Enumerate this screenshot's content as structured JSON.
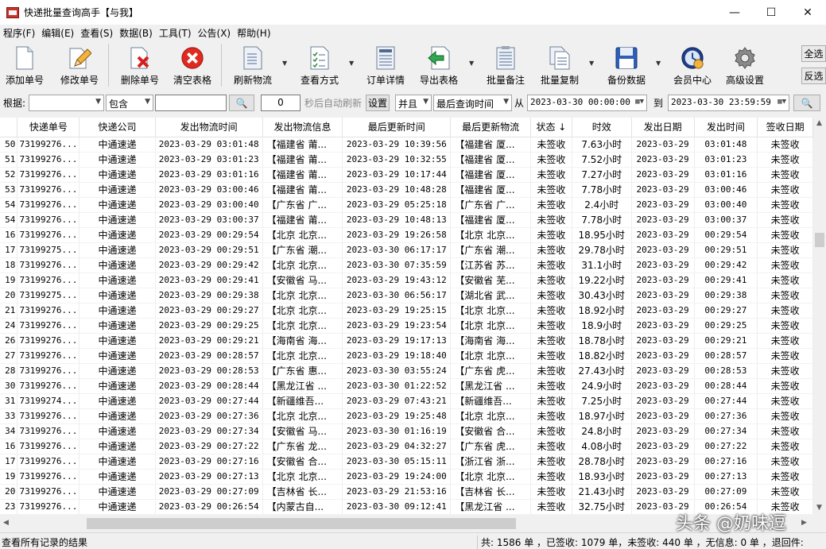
{
  "window": {
    "title": "快递批量查询高手【与我】",
    "minimize_glyph": "—",
    "maximize_glyph": "☐",
    "close_glyph": "✕"
  },
  "menu": [
    "程序(F)",
    "编辑(E)",
    "查看(S)",
    "数据(B)",
    "工具(T)",
    "公告(X)",
    "帮助(H)"
  ],
  "toolbar": {
    "buttons": [
      {
        "label": "添加单号",
        "icon": "document-icon"
      },
      {
        "label": "修改单号",
        "icon": "pencil-icon"
      },
      {
        "label": "删除单号",
        "icon": "delete-document-icon"
      },
      {
        "label": "清空表格",
        "icon": "red-x-circle-icon"
      },
      {
        "label": "刷新物流",
        "icon": "refresh-list-icon"
      },
      {
        "label": "查看方式",
        "icon": "checklist-icon"
      },
      {
        "label": "订单详情",
        "icon": "order-detail-icon"
      },
      {
        "label": "导出表格",
        "icon": "export-arrow-icon"
      },
      {
        "label": "批量备注",
        "icon": "note-icon"
      },
      {
        "label": "批量复制",
        "icon": "copy-icon"
      },
      {
        "label": "备份数据",
        "icon": "floppy-disk-icon"
      },
      {
        "label": "会员中心",
        "icon": "clock-user-icon"
      },
      {
        "label": "高级设置",
        "icon": "gear-icon"
      }
    ],
    "select_all": "全选",
    "invert_select": "反选"
  },
  "filter": {
    "label_basis": "根据:",
    "basis_value": "",
    "match_value": "包含",
    "search_text": "",
    "refresh_seconds": "0",
    "refresh_hint": "秒后自动刷新",
    "settings_button": "设置",
    "logic_value": "并且",
    "time_field_value": "最后查询时间",
    "from_label": "从",
    "from_datetime": "2023-03-30 00:00:00",
    "to_label": "到",
    "to_datetime": "2023-03-30 23:59:59"
  },
  "table": {
    "columns": [
      "",
      "快递单号",
      "快递公司",
      "发出物流时间",
      "发出物流信息",
      "最后更新时间",
      "最后更新物流",
      "状态 ↓",
      "时效",
      "发出日期",
      "发出时间",
      "签收日期"
    ],
    "rows": [
      [
        "50",
        "73199276...",
        "中通速递",
        "2023-03-29 03:01:48",
        "【福建省 莆...",
        "2023-03-29 10:39:56",
        "【福建省 厦...",
        "未签收",
        "7.63小时",
        "2023-03-29",
        "03:01:48",
        "未签收"
      ],
      [
        "51",
        "73199276...",
        "中通速递",
        "2023-03-29 03:01:23",
        "【福建省 莆...",
        "2023-03-29 10:32:55",
        "【福建省 厦...",
        "未签收",
        "7.52小时",
        "2023-03-29",
        "03:01:23",
        "未签收"
      ],
      [
        "52",
        "73199276...",
        "中通速递",
        "2023-03-29 03:01:16",
        "【福建省 莆...",
        "2023-03-29 10:17:44",
        "【福建省 厦...",
        "未签收",
        "7.27小时",
        "2023-03-29",
        "03:01:16",
        "未签收"
      ],
      [
        "53",
        "73199276...",
        "中通速递",
        "2023-03-29 03:00:46",
        "【福建省 莆...",
        "2023-03-29 10:48:28",
        "【福建省 厦...",
        "未签收",
        "7.78小时",
        "2023-03-29",
        "03:00:46",
        "未签收"
      ],
      [
        "54",
        "73199276...",
        "中通速递",
        "2023-03-29 03:00:40",
        "【广东省 广...",
        "2023-03-29 05:25:18",
        "【广东省 广...",
        "未签收",
        "2.4小时",
        "2023-03-29",
        "03:00:40",
        "未签收"
      ],
      [
        "54",
        "73199276...",
        "中通速递",
        "2023-03-29 03:00:37",
        "【福建省 莆...",
        "2023-03-29 10:48:13",
        "【福建省 厦...",
        "未签收",
        "7.78小时",
        "2023-03-29",
        "03:00:37",
        "未签收"
      ],
      [
        "16",
        "73199276...",
        "中通速递",
        "2023-03-29 00:29:54",
        "【北京 北京...",
        "2023-03-29 19:26:58",
        "【北京 北京...",
        "未签收",
        "18.95小时",
        "2023-03-29",
        "00:29:54",
        "未签收"
      ],
      [
        "17",
        "73199275...",
        "中通速递",
        "2023-03-29 00:29:51",
        "【广东省 潮...",
        "2023-03-30 06:17:17",
        "【广东省 潮...",
        "未签收",
        "29.78小时",
        "2023-03-29",
        "00:29:51",
        "未签收"
      ],
      [
        "18",
        "73199276...",
        "中通速递",
        "2023-03-29 00:29:42",
        "【北京 北京...",
        "2023-03-30 07:35:59",
        "【江苏省 苏...",
        "未签收",
        "31.1小时",
        "2023-03-29",
        "00:29:42",
        "未签收"
      ],
      [
        "19",
        "73199276...",
        "中通速递",
        "2023-03-29 00:29:41",
        "【安徽省 马...",
        "2023-03-29 19:43:12",
        "【安徽省 芜...",
        "未签收",
        "19.22小时",
        "2023-03-29",
        "00:29:41",
        "未签收"
      ],
      [
        "20",
        "73199275...",
        "中通速递",
        "2023-03-29 00:29:38",
        "【北京 北京...",
        "2023-03-30 06:56:17",
        "【湖北省 武...",
        "未签收",
        "30.43小时",
        "2023-03-29",
        "00:29:38",
        "未签收"
      ],
      [
        "21",
        "73199276...",
        "中通速递",
        "2023-03-29 00:29:27",
        "【北京 北京...",
        "2023-03-29 19:25:15",
        "【北京 北京...",
        "未签收",
        "18.92小时",
        "2023-03-29",
        "00:29:27",
        "未签收"
      ],
      [
        "24",
        "73199276...",
        "中通速递",
        "2023-03-29 00:29:25",
        "【北京 北京...",
        "2023-03-29 19:23:54",
        "【北京 北京...",
        "未签收",
        "18.9小时",
        "2023-03-29",
        "00:29:25",
        "未签收"
      ],
      [
        "26",
        "73199276...",
        "中通速递",
        "2023-03-29 00:29:21",
        "【海南省 海...",
        "2023-03-29 19:17:13",
        "【海南省 海...",
        "未签收",
        "18.78小时",
        "2023-03-29",
        "00:29:21",
        "未签收"
      ],
      [
        "27",
        "73199276...",
        "中通速递",
        "2023-03-29 00:28:57",
        "【北京 北京...",
        "2023-03-29 19:18:40",
        "【北京 北京...",
        "未签收",
        "18.82小时",
        "2023-03-29",
        "00:28:57",
        "未签收"
      ],
      [
        "28",
        "73199276...",
        "中通速递",
        "2023-03-29 00:28:53",
        "【广东省 惠...",
        "2023-03-30 03:55:24",
        "【广东省 虎...",
        "未签收",
        "27.43小时",
        "2023-03-29",
        "00:28:53",
        "未签收"
      ],
      [
        "30",
        "73199276...",
        "中通速递",
        "2023-03-29 00:28:44",
        "【黑龙江省 ...",
        "2023-03-30 01:22:52",
        "【黑龙江省 ...",
        "未签收",
        "24.9小时",
        "2023-03-29",
        "00:28:44",
        "未签收"
      ],
      [
        "31",
        "73199274...",
        "中通速递",
        "2023-03-29 00:27:44",
        "【新疆维吾...",
        "2023-03-29 07:43:21",
        "【新疆维吾...",
        "未签收",
        "7.25小时",
        "2023-03-29",
        "00:27:44",
        "未签收"
      ],
      [
        "33",
        "73199276...",
        "中通速递",
        "2023-03-29 00:27:36",
        "【北京 北京...",
        "2023-03-29 19:25:48",
        "【北京 北京...",
        "未签收",
        "18.97小时",
        "2023-03-29",
        "00:27:36",
        "未签收"
      ],
      [
        "34",
        "73199276...",
        "中通速递",
        "2023-03-29 00:27:34",
        "【安徽省 马...",
        "2023-03-30 01:16:19",
        "【安徽省 合...",
        "未签收",
        "24.8小时",
        "2023-03-29",
        "00:27:34",
        "未签收"
      ],
      [
        "16",
        "73199276...",
        "中通速递",
        "2023-03-29 00:27:22",
        "【广东省 龙...",
        "2023-03-29 04:32:27",
        "【广东省 虎...",
        "未签收",
        "4.08小时",
        "2023-03-29",
        "00:27:22",
        "未签收"
      ],
      [
        "17",
        "73199276...",
        "中通速递",
        "2023-03-29 00:27:16",
        "【安徽省 合...",
        "2023-03-30 05:15:11",
        "【浙江省 浙...",
        "未签收",
        "28.78小时",
        "2023-03-29",
        "00:27:16",
        "未签收"
      ],
      [
        "19",
        "73199276...",
        "中通速递",
        "2023-03-29 00:27:13",
        "【北京 北京...",
        "2023-03-29 19:24:00",
        "【北京 北京...",
        "未签收",
        "18.93小时",
        "2023-03-29",
        "00:27:13",
        "未签收"
      ],
      [
        "20",
        "73199276...",
        "中通速递",
        "2023-03-29 00:27:09",
        "【吉林省 长...",
        "2023-03-29 21:53:16",
        "【吉林省 长...",
        "未签收",
        "21.43小时",
        "2023-03-29",
        "00:27:09",
        "未签收"
      ],
      [
        "23",
        "73199276...",
        "中通速递",
        "2023-03-29 00:26:54",
        "【内蒙古自...",
        "2023-03-30 09:12:41",
        "【黑龙江省 ...",
        "未签收",
        "32.75小时",
        "2023-03-29",
        "00:26:54",
        "未签收"
      ]
    ]
  },
  "status": {
    "left": "查看所有记录的结果",
    "right": "共: 1586 单 ，已签收: 1079 单，未签收: 440 单 ，无信息: 0 单 ，退回件:"
  },
  "watermark": "头条 @奶味逗"
}
